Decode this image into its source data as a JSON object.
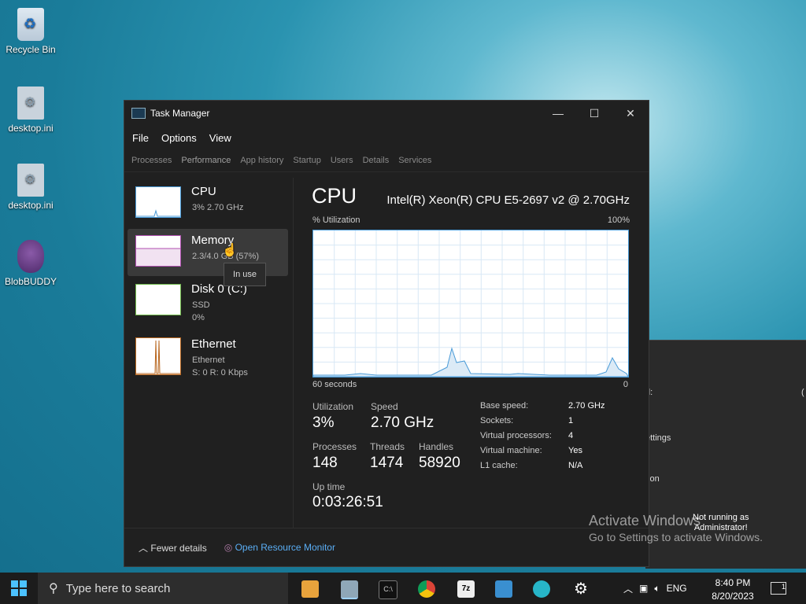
{
  "desktop": {
    "icons": [
      {
        "label": "Recycle Bin",
        "icon": "recycle-bin-icon"
      },
      {
        "label": "desktop.ini",
        "icon": "settings-file-icon"
      },
      {
        "label": "desktop.ini",
        "icon": "settings-file-icon"
      },
      {
        "label": "BlobBUDDY",
        "icon": "blobbuddy-icon"
      }
    ]
  },
  "window": {
    "title": "Task Manager",
    "menu": [
      "File",
      "Options",
      "View"
    ],
    "tabs": [
      "Processes",
      "Performance",
      "App history",
      "Startup",
      "Users",
      "Details",
      "Services"
    ],
    "active_tab": "Performance"
  },
  "sidebar": {
    "items": [
      {
        "title": "CPU",
        "sub1": "3% 2.70 GHz",
        "sub2": ""
      },
      {
        "title": "Memory",
        "sub1": "2.3/4.0 GB (57%)",
        "sub2": ""
      },
      {
        "title": "Disk 0 (C:)",
        "sub1": "SSD",
        "sub2": "0%"
      },
      {
        "title": "Ethernet",
        "sub1": "Ethernet",
        "sub2": "S: 0 R: 0 Kbps"
      }
    ],
    "tooltip": "In use"
  },
  "cpu": {
    "title": "CPU",
    "model": "Intel(R) Xeon(R) CPU E5-2697 v2 @ 2.70GHz",
    "util_label": "% Utilization",
    "util_max": "100%",
    "time_left": "60 seconds",
    "time_right": "0",
    "stats": {
      "utilization_label": "Utilization",
      "utilization": "3%",
      "speed_label": "Speed",
      "speed": "2.70 GHz",
      "processes_label": "Processes",
      "processes": "148",
      "threads_label": "Threads",
      "threads": "1474",
      "handles_label": "Handles",
      "handles": "58920",
      "uptime_label": "Up time",
      "uptime": "0:03:26:51"
    },
    "details": [
      {
        "k": "Base speed:",
        "v": "2.70 GHz"
      },
      {
        "k": "Sockets:",
        "v": "1"
      },
      {
        "k": "Virtual processors:",
        "v": "4"
      },
      {
        "k": "Virtual machine:",
        "v": "Yes"
      },
      {
        "k": "L1 cache:",
        "v": "N/A"
      }
    ]
  },
  "footer": {
    "fewer": "Fewer details",
    "resource_monitor": "Open Resource Monitor"
  },
  "background_window": {
    "lines": [
      "d:",
      "ettings",
      "l",
      "tion"
    ],
    "edge_char": "("
  },
  "watermark": {
    "line1": "Activate Windows",
    "line2": "Go to Settings to activate Windows."
  },
  "admin_note": {
    "line1": "Not running as",
    "line2": "Administrator!"
  },
  "taskbar": {
    "search_placeholder": "Type here to search",
    "lang": "ENG",
    "time": "8:40 PM",
    "date": "8/20/2023",
    "notifications": "1"
  },
  "colors": {
    "accent": "#4a9bd8",
    "memory": "#b04fb0",
    "disk": "#6fb84a",
    "ethernet": "#b8661e"
  }
}
